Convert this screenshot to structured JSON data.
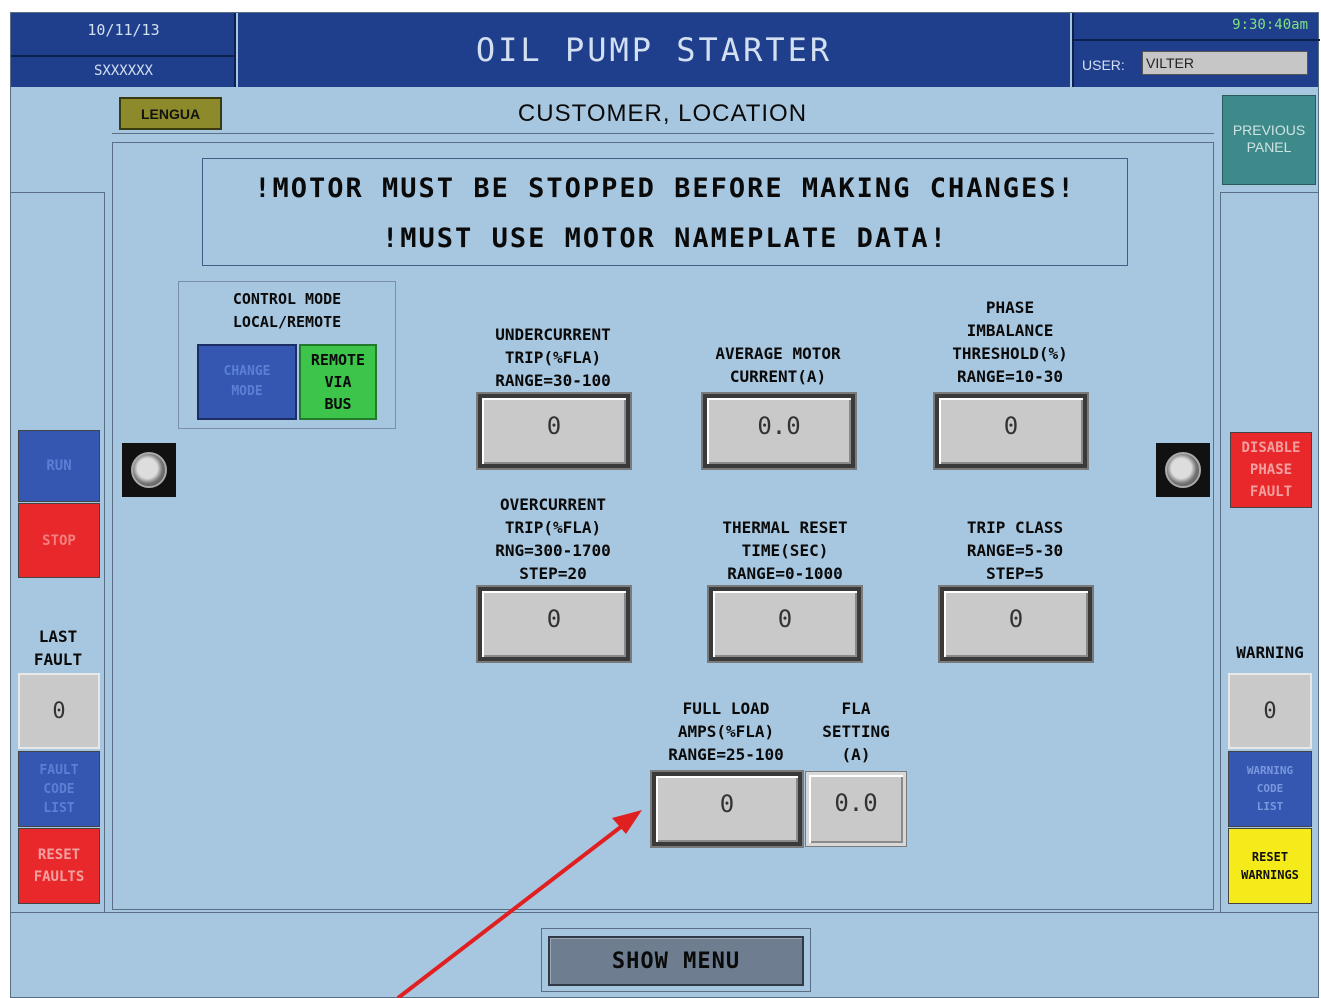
{
  "header": {
    "date": "10/11/13",
    "serial": "SXXXXXX",
    "title": "OIL PUMP STARTER",
    "time": "9:30:40am",
    "user_label": "USER:",
    "user_value": "VILTER"
  },
  "subheader": {
    "lengua_label": "LENGUA",
    "location": "CUSTOMER, LOCATION",
    "previous_panel": "PREVIOUS\nPANEL"
  },
  "warning_banner": {
    "line1": "!MOTOR MUST BE STOPPED BEFORE MAKING CHANGES!",
    "line2": "!MUST USE MOTOR NAMEPLATE DATA!"
  },
  "control_mode": {
    "title": "CONTROL MODE\nLOCAL/REMOTE",
    "change_button": "CHANGE\nMODE",
    "status": "REMOTE\nVIA\nBUS"
  },
  "parameters": {
    "undercurrent": {
      "label": "UNDERCURRENT\nTRIP(%FLA)\nRANGE=30-100",
      "value": "0"
    },
    "avg_current": {
      "label": "AVERAGE MOTOR\nCURRENT(A)",
      "value": "0.0"
    },
    "phase_imbalance": {
      "label": "PHASE\nIMBALANCE\nTHRESHOLD(%)\nRANGE=10-30",
      "value": "0"
    },
    "overcurrent": {
      "label": "OVERCURRENT\nTRIP(%FLA)\nRNG=300-1700\nSTEP=20",
      "value": "0"
    },
    "thermal_reset": {
      "label": "THERMAL RESET\nTIME(SEC)\nRANGE=0-1000",
      "value": "0"
    },
    "trip_class": {
      "label": "TRIP CLASS\nRANGE=5-30\nSTEP=5",
      "value": "0"
    },
    "full_load_amps": {
      "label": "FULL LOAD\nAMPS(%FLA)\nRANGE=25-100",
      "value": "0"
    },
    "fla_setting": {
      "label": "FLA\nSETTING\n(A)",
      "value": "0.0"
    }
  },
  "left_panel": {
    "run": "RUN",
    "stop": "STOP",
    "last_fault_label": "LAST\nFAULT",
    "last_fault_value": "0",
    "fault_code_list": "FAULT\nCODE\nLIST",
    "reset_faults": "RESET\nFAULTS"
  },
  "right_panel": {
    "disable_phase_fault": "DISABLE\nPHASE\nFAULT",
    "warning_label": "WARNING",
    "warning_value": "0",
    "warning_code_list": "WARNING\nCODE\nLIST",
    "reset_warnings": "RESET\nWARNINGS"
  },
  "footer": {
    "show_menu": "SHOW MENU"
  },
  "colors": {
    "background": "#a7c6df",
    "header": "#1f3f8c",
    "run": "#3557b2",
    "stop": "#e8282a",
    "remote": "#3cc44b",
    "warning_yellow": "#f5ea1a",
    "previous_panel": "#3e8a8a",
    "annotation_arrow": "#e02020"
  }
}
